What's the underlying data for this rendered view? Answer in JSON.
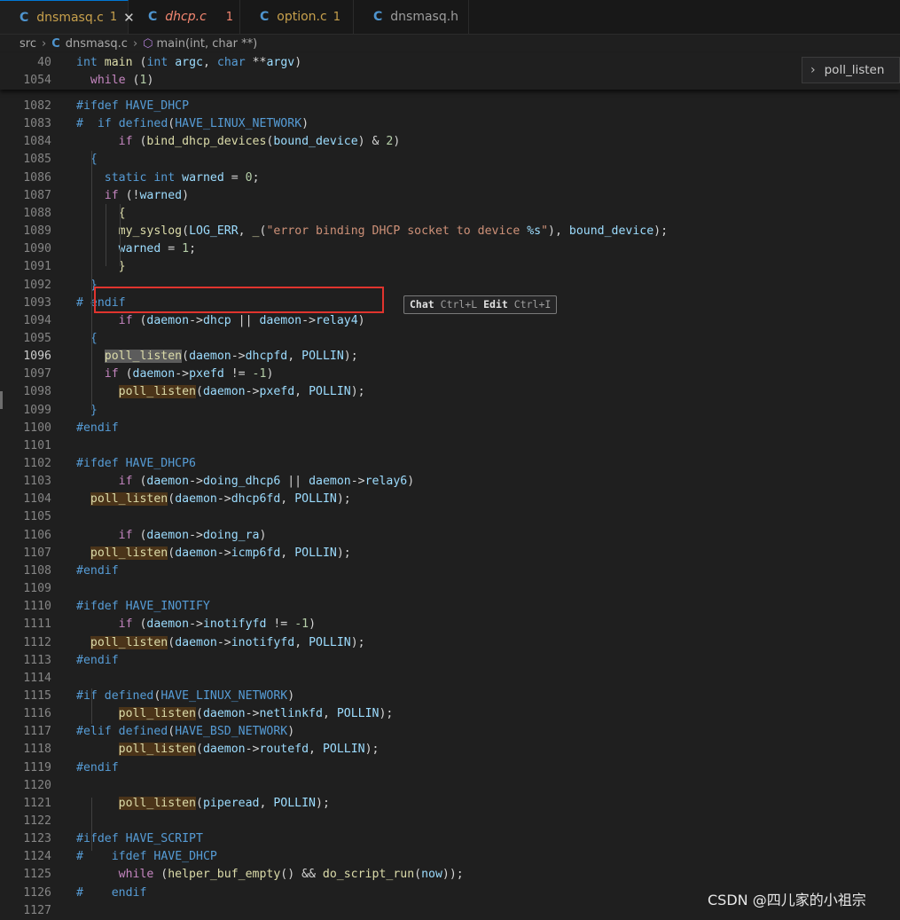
{
  "tabs": [
    {
      "name": "dnsmasq.c",
      "badge": "1",
      "active": true,
      "style": "mod",
      "close": "✕"
    },
    {
      "name": "dhcp.c",
      "badge": "1",
      "active": false,
      "style": "err",
      "close": ""
    },
    {
      "name": "option.c",
      "badge": "1",
      "active": false,
      "style": "mod",
      "close": ""
    },
    {
      "name": "dnsmasq.h",
      "badge": "",
      "active": false,
      "style": "",
      "close": ""
    }
  ],
  "breadcrumb": {
    "folder": "src",
    "file": "dnsmasq.c",
    "symbol": "main(int, char **)"
  },
  "sticky_lines": [
    {
      "num": "40",
      "tokens": [
        [
          "kw",
          "int"
        ],
        [
          "plain",
          " "
        ],
        [
          "fn",
          "main"
        ],
        [
          "plain",
          " ("
        ],
        [
          "kw",
          "int"
        ],
        [
          "plain",
          " "
        ],
        [
          "var",
          "argc"
        ],
        [
          "plain",
          ", "
        ],
        [
          "kw",
          "char"
        ],
        [
          "plain",
          " **"
        ],
        [
          "var",
          "argv"
        ],
        [
          "plain",
          ")"
        ]
      ]
    },
    {
      "num": "1054",
      "tokens": [
        [
          "plain",
          "  "
        ],
        [
          "ctl",
          "while"
        ],
        [
          "plain",
          " ("
        ],
        [
          "num",
          "1"
        ],
        [
          "plain",
          ")"
        ]
      ]
    }
  ],
  "lines": [
    {
      "num": "1082",
      "tokens": [
        [
          "pp",
          "#ifdef"
        ],
        [
          "plain",
          " "
        ],
        [
          "mac",
          "HAVE_DHCP"
        ]
      ]
    },
    {
      "num": "1083",
      "tokens": [
        [
          "pp",
          "#"
        ],
        [
          "plain",
          "  "
        ],
        [
          "pp",
          "if"
        ],
        [
          "plain",
          " "
        ],
        [
          "pp",
          "defined"
        ],
        [
          "plain",
          "("
        ],
        [
          "mac",
          "HAVE_LINUX_NETWORK"
        ],
        [
          "plain",
          ")"
        ]
      ]
    },
    {
      "num": "1084",
      "tokens": [
        [
          "plain",
          "      "
        ],
        [
          "ctl",
          "if"
        ],
        [
          "plain",
          " ("
        ],
        [
          "fn",
          "bind_dhcp_devices"
        ],
        [
          "plain",
          "("
        ],
        [
          "var",
          "bound_device"
        ],
        [
          "plain",
          ") & "
        ],
        [
          "num",
          "2"
        ],
        [
          "plain",
          ")"
        ]
      ]
    },
    {
      "num": "1085",
      "tokens": [
        [
          "plain",
          "  "
        ],
        [
          "kw",
          "{"
        ]
      ]
    },
    {
      "num": "1086",
      "tokens": [
        [
          "plain",
          "    "
        ],
        [
          "kw",
          "static"
        ],
        [
          "plain",
          " "
        ],
        [
          "kw",
          "int"
        ],
        [
          "plain",
          " "
        ],
        [
          "var",
          "warned"
        ],
        [
          "plain",
          " = "
        ],
        [
          "num",
          "0"
        ],
        [
          "plain",
          ";"
        ]
      ]
    },
    {
      "num": "1087",
      "tokens": [
        [
          "plain",
          "    "
        ],
        [
          "ctl",
          "if"
        ],
        [
          "plain",
          " (!"
        ],
        [
          "var",
          "warned"
        ],
        [
          "plain",
          ")"
        ]
      ]
    },
    {
      "num": "1088",
      "tokens": [
        [
          "plain",
          "      "
        ],
        [
          "fn",
          "{"
        ]
      ]
    },
    {
      "num": "1089",
      "tokens": [
        [
          "plain",
          "      "
        ],
        [
          "fn",
          "my_syslog"
        ],
        [
          "plain",
          "("
        ],
        [
          "var",
          "LOG_ERR"
        ],
        [
          "plain",
          ", "
        ],
        [
          "fn",
          "_"
        ],
        [
          "plain",
          "("
        ],
        [
          "str",
          "\"error binding DHCP socket to device "
        ],
        [
          "var",
          "%s"
        ],
        [
          "str",
          "\""
        ],
        [
          "plain",
          "), "
        ],
        [
          "var",
          "bound_device"
        ],
        [
          "plain",
          ");"
        ]
      ]
    },
    {
      "num": "1090",
      "tokens": [
        [
          "plain",
          "      "
        ],
        [
          "var",
          "warned"
        ],
        [
          "plain",
          " = "
        ],
        [
          "num",
          "1"
        ],
        [
          "plain",
          ";"
        ]
      ]
    },
    {
      "num": "1091",
      "tokens": [
        [
          "plain",
          "      "
        ],
        [
          "fn",
          "}"
        ]
      ]
    },
    {
      "num": "1092",
      "tokens": [
        [
          "plain",
          "  "
        ],
        [
          "kw",
          "}"
        ]
      ]
    },
    {
      "num": "1093",
      "tokens": [
        [
          "pp",
          "#"
        ],
        [
          "plain",
          " "
        ],
        [
          "pp",
          "endif"
        ]
      ]
    },
    {
      "num": "1094",
      "tokens": [
        [
          "plain",
          "      "
        ],
        [
          "ctl",
          "if"
        ],
        [
          "plain",
          " ("
        ],
        [
          "var",
          "daemon"
        ],
        [
          "plain",
          "->"
        ],
        [
          "var",
          "dhcp"
        ],
        [
          "plain",
          " || "
        ],
        [
          "var",
          "daemon"
        ],
        [
          "plain",
          "->"
        ],
        [
          "var",
          "relay4"
        ],
        [
          "plain",
          ")"
        ]
      ]
    },
    {
      "num": "1095",
      "tokens": [
        [
          "plain",
          "  "
        ],
        [
          "kw",
          "{"
        ]
      ]
    },
    {
      "num": "1096",
      "tokens": [
        [
          "plain",
          "    "
        ],
        [
          "fnhs",
          "poll_listen"
        ],
        [
          "plain",
          "("
        ],
        [
          "var",
          "daemon"
        ],
        [
          "plain",
          "->"
        ],
        [
          "var",
          "dhcpfd"
        ],
        [
          "plain",
          ", "
        ],
        [
          "var",
          "POLLIN"
        ],
        [
          "plain",
          ");"
        ]
      ],
      "current": true
    },
    {
      "num": "1097",
      "tokens": [
        [
          "plain",
          "    "
        ],
        [
          "ctl",
          "if"
        ],
        [
          "plain",
          " ("
        ],
        [
          "var",
          "daemon"
        ],
        [
          "plain",
          "->"
        ],
        [
          "var",
          "pxefd"
        ],
        [
          "plain",
          " != "
        ],
        [
          "num",
          "-1"
        ],
        [
          "plain",
          ")"
        ]
      ]
    },
    {
      "num": "1098",
      "tokens": [
        [
          "plain",
          "      "
        ],
        [
          "fnh",
          "poll_listen"
        ],
        [
          "plain",
          "("
        ],
        [
          "var",
          "daemon"
        ],
        [
          "plain",
          "->"
        ],
        [
          "var",
          "pxefd"
        ],
        [
          "plain",
          ", "
        ],
        [
          "var",
          "POLLIN"
        ],
        [
          "plain",
          ");"
        ]
      ]
    },
    {
      "num": "1099",
      "tokens": [
        [
          "plain",
          "  "
        ],
        [
          "kw",
          "}"
        ]
      ]
    },
    {
      "num": "1100",
      "tokens": [
        [
          "pp",
          "#endif"
        ]
      ]
    },
    {
      "num": "1101",
      "tokens": []
    },
    {
      "num": "1102",
      "tokens": [
        [
          "pp",
          "#ifdef"
        ],
        [
          "plain",
          " "
        ],
        [
          "mac",
          "HAVE_DHCP6"
        ]
      ]
    },
    {
      "num": "1103",
      "tokens": [
        [
          "plain",
          "      "
        ],
        [
          "ctl",
          "if"
        ],
        [
          "plain",
          " ("
        ],
        [
          "var",
          "daemon"
        ],
        [
          "plain",
          "->"
        ],
        [
          "var",
          "doing_dhcp6"
        ],
        [
          "plain",
          " || "
        ],
        [
          "var",
          "daemon"
        ],
        [
          "plain",
          "->"
        ],
        [
          "var",
          "relay6"
        ],
        [
          "plain",
          ")"
        ]
      ]
    },
    {
      "num": "1104",
      "tokens": [
        [
          "plain",
          "  "
        ],
        [
          "fnh",
          "poll_listen"
        ],
        [
          "plain",
          "("
        ],
        [
          "var",
          "daemon"
        ],
        [
          "plain",
          "->"
        ],
        [
          "var",
          "dhcp6fd"
        ],
        [
          "plain",
          ", "
        ],
        [
          "var",
          "POLLIN"
        ],
        [
          "plain",
          ");"
        ]
      ]
    },
    {
      "num": "1105",
      "tokens": []
    },
    {
      "num": "1106",
      "tokens": [
        [
          "plain",
          "      "
        ],
        [
          "ctl",
          "if"
        ],
        [
          "plain",
          " ("
        ],
        [
          "var",
          "daemon"
        ],
        [
          "plain",
          "->"
        ],
        [
          "var",
          "doing_ra"
        ],
        [
          "plain",
          ")"
        ]
      ]
    },
    {
      "num": "1107",
      "tokens": [
        [
          "plain",
          "  "
        ],
        [
          "fnh",
          "poll_listen"
        ],
        [
          "plain",
          "("
        ],
        [
          "var",
          "daemon"
        ],
        [
          "plain",
          "->"
        ],
        [
          "var",
          "icmp6fd"
        ],
        [
          "plain",
          ", "
        ],
        [
          "var",
          "POLLIN"
        ],
        [
          "plain",
          ");"
        ]
      ]
    },
    {
      "num": "1108",
      "tokens": [
        [
          "pp",
          "#endif"
        ]
      ]
    },
    {
      "num": "1109",
      "tokens": []
    },
    {
      "num": "1110",
      "tokens": [
        [
          "pp",
          "#ifdef"
        ],
        [
          "plain",
          " "
        ],
        [
          "mac",
          "HAVE_INOTIFY"
        ]
      ]
    },
    {
      "num": "1111",
      "tokens": [
        [
          "plain",
          "      "
        ],
        [
          "ctl",
          "if"
        ],
        [
          "plain",
          " ("
        ],
        [
          "var",
          "daemon"
        ],
        [
          "plain",
          "->"
        ],
        [
          "var",
          "inotifyfd"
        ],
        [
          "plain",
          " != "
        ],
        [
          "num",
          "-1"
        ],
        [
          "plain",
          ")"
        ]
      ]
    },
    {
      "num": "1112",
      "tokens": [
        [
          "plain",
          "  "
        ],
        [
          "fnh",
          "poll_listen"
        ],
        [
          "plain",
          "("
        ],
        [
          "var",
          "daemon"
        ],
        [
          "plain",
          "->"
        ],
        [
          "var",
          "inotifyfd"
        ],
        [
          "plain",
          ", "
        ],
        [
          "var",
          "POLLIN"
        ],
        [
          "plain",
          ");"
        ]
      ]
    },
    {
      "num": "1113",
      "tokens": [
        [
          "pp",
          "#endif"
        ]
      ]
    },
    {
      "num": "1114",
      "tokens": []
    },
    {
      "num": "1115",
      "tokens": [
        [
          "pp",
          "#if"
        ],
        [
          "plain",
          " "
        ],
        [
          "pp",
          "defined"
        ],
        [
          "plain",
          "("
        ],
        [
          "mac",
          "HAVE_LINUX_NETWORK"
        ],
        [
          "plain",
          ")"
        ]
      ]
    },
    {
      "num": "1116",
      "tokens": [
        [
          "plain",
          "      "
        ],
        [
          "fnh",
          "poll_listen"
        ],
        [
          "plain",
          "("
        ],
        [
          "var",
          "daemon"
        ],
        [
          "plain",
          "->"
        ],
        [
          "var",
          "netlinkfd"
        ],
        [
          "plain",
          ", "
        ],
        [
          "var",
          "POLLIN"
        ],
        [
          "plain",
          ");"
        ]
      ]
    },
    {
      "num": "1117",
      "tokens": [
        [
          "pp",
          "#elif"
        ],
        [
          "plain",
          " "
        ],
        [
          "pp",
          "defined"
        ],
        [
          "plain",
          "("
        ],
        [
          "mac",
          "HAVE_BSD_NETWORK"
        ],
        [
          "plain",
          ")"
        ]
      ]
    },
    {
      "num": "1118",
      "tokens": [
        [
          "plain",
          "      "
        ],
        [
          "fnh",
          "poll_listen"
        ],
        [
          "plain",
          "("
        ],
        [
          "var",
          "daemon"
        ],
        [
          "plain",
          "->"
        ],
        [
          "var",
          "routefd"
        ],
        [
          "plain",
          ", "
        ],
        [
          "var",
          "POLLIN"
        ],
        [
          "plain",
          ");"
        ]
      ]
    },
    {
      "num": "1119",
      "tokens": [
        [
          "pp",
          "#endif"
        ]
      ]
    },
    {
      "num": "1120",
      "tokens": []
    },
    {
      "num": "1121",
      "tokens": [
        [
          "plain",
          "      "
        ],
        [
          "fnh",
          "poll_listen"
        ],
        [
          "plain",
          "("
        ],
        [
          "var",
          "piperead"
        ],
        [
          "plain",
          ", "
        ],
        [
          "var",
          "POLLIN"
        ],
        [
          "plain",
          ");"
        ]
      ]
    },
    {
      "num": "1122",
      "tokens": []
    },
    {
      "num": "1123",
      "tokens": [
        [
          "pp",
          "#ifdef"
        ],
        [
          "plain",
          " "
        ],
        [
          "mac",
          "HAVE_SCRIPT"
        ]
      ]
    },
    {
      "num": "1124",
      "tokens": [
        [
          "pp",
          "#"
        ],
        [
          "plain",
          "    "
        ],
        [
          "pp",
          "ifdef"
        ],
        [
          "plain",
          " "
        ],
        [
          "mac",
          "HAVE_DHCP"
        ]
      ]
    },
    {
      "num": "1125",
      "tokens": [
        [
          "plain",
          "      "
        ],
        [
          "ctl",
          "while"
        ],
        [
          "plain",
          " ("
        ],
        [
          "fn",
          "helper_buf_empty"
        ],
        [
          "plain",
          "() && "
        ],
        [
          "fn",
          "do_script_run"
        ],
        [
          "plain",
          "("
        ],
        [
          "var",
          "now"
        ],
        [
          "plain",
          "));"
        ]
      ]
    },
    {
      "num": "1126",
      "tokens": [
        [
          "pp",
          "#"
        ],
        [
          "plain",
          "    "
        ],
        [
          "pp",
          "endif"
        ]
      ]
    },
    {
      "num": "1127",
      "tokens": []
    }
  ],
  "inline_hint": {
    "chat_label": "Chat",
    "chat_key": "Ctrl+L",
    "edit_label": "Edit",
    "edit_key": "Ctrl+I"
  },
  "outline_widget": {
    "label": "poll_listen"
  },
  "watermark": "CSDN @四儿家的小祖宗"
}
